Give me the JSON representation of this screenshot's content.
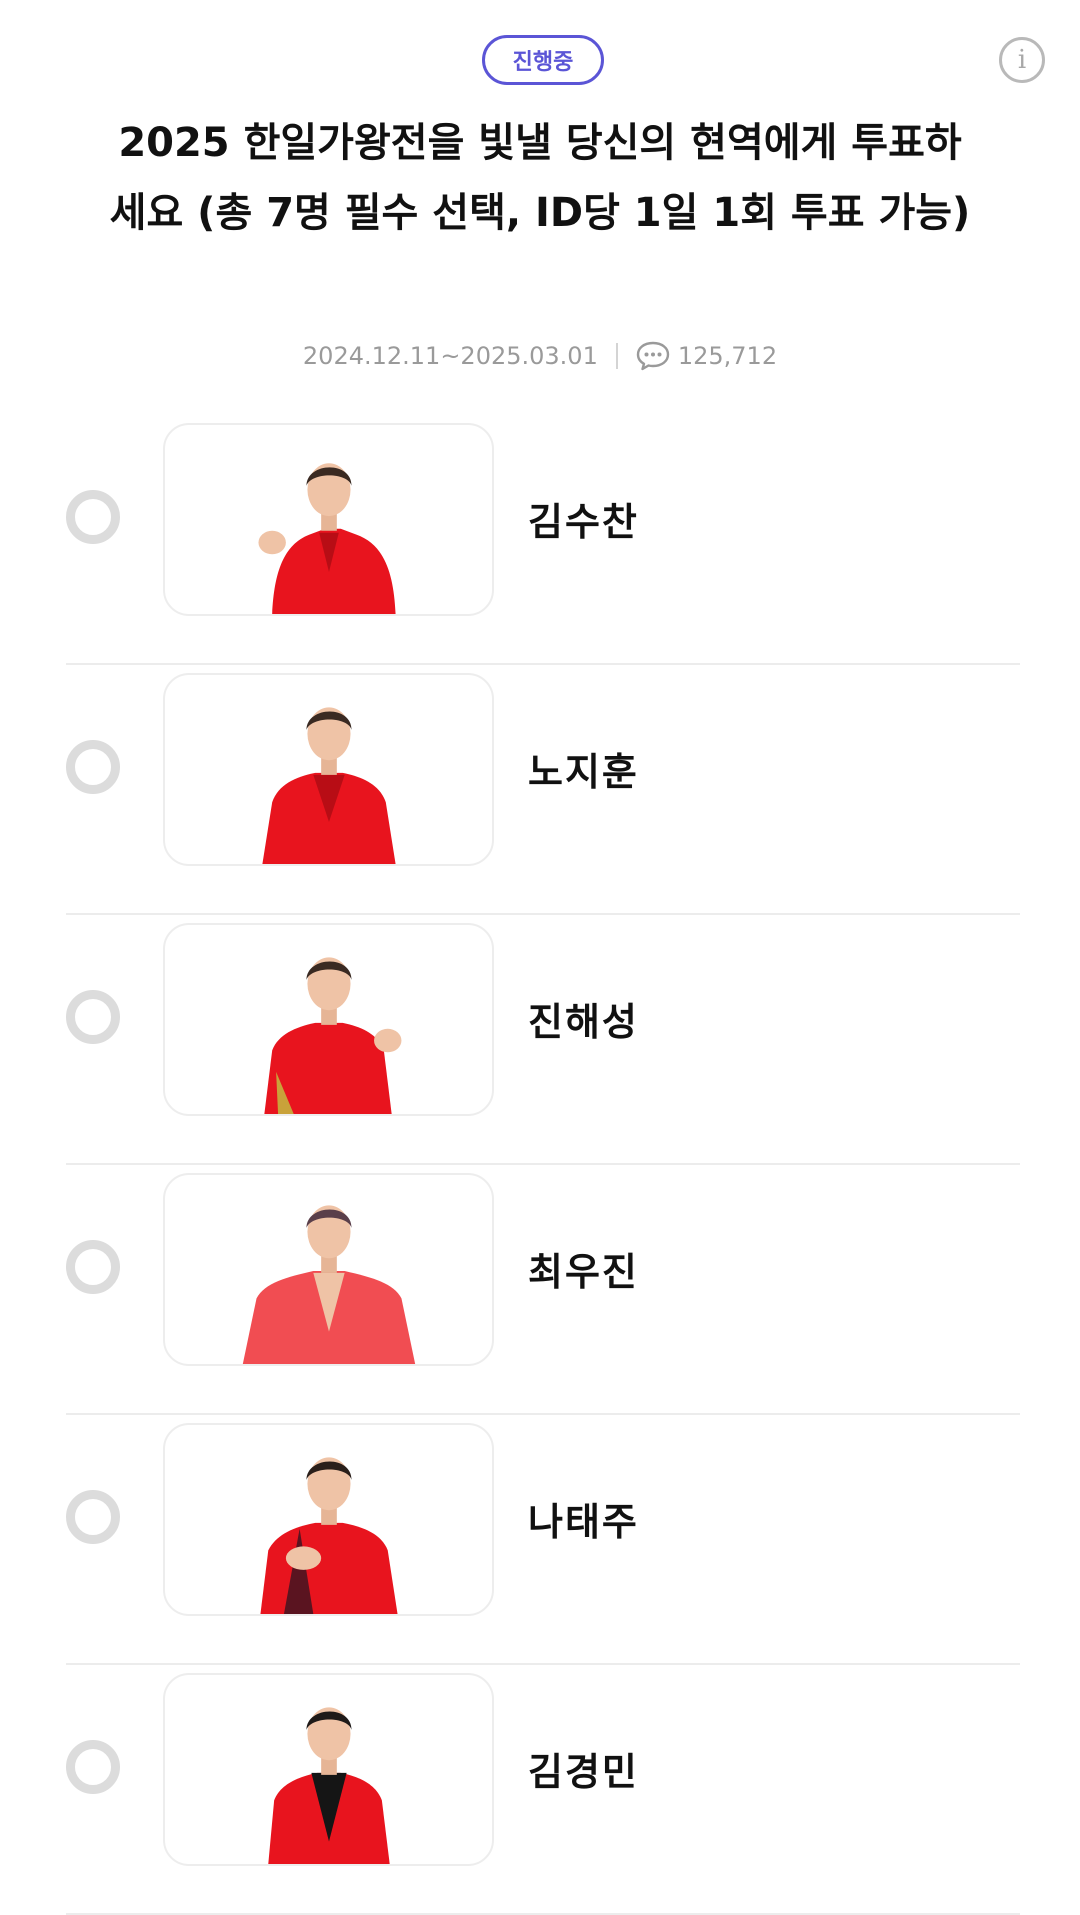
{
  "header": {
    "status_badge": "진행중",
    "title": "2025 한일가왕전을 빛낼 당신의 현역에게 투표하세요 (총 7명 필수 선택, ID당 1일 1회 투표 가능)",
    "date_range": "2024.12.11~2025.03.01",
    "comment_count": "125,712",
    "info_icon": "info-icon",
    "comment_icon": "speech-bubble-icon"
  },
  "candidates": [
    {
      "name": "김수찬"
    },
    {
      "name": "노지훈"
    },
    {
      "name": "진해성"
    },
    {
      "name": "최우진"
    },
    {
      "name": "나태주"
    },
    {
      "name": "김경민"
    }
  ],
  "colors": {
    "accent": "#5b55d6",
    "costume_red": "#e8141e",
    "radio_gray": "#dcdcdc"
  }
}
